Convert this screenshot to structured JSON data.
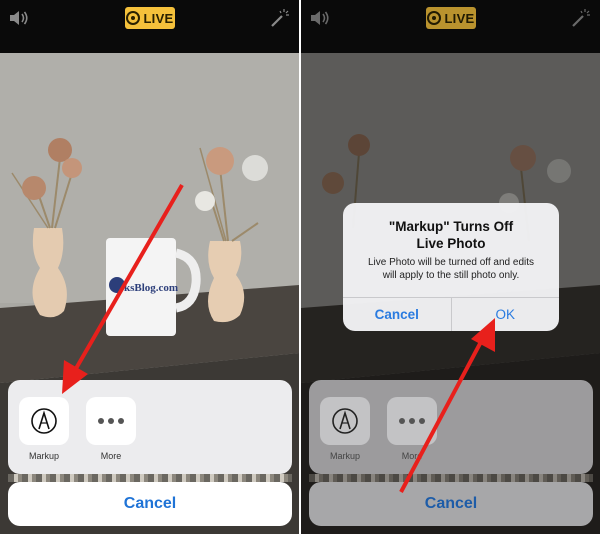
{
  "left": {
    "live_badge": "LIVE",
    "actions": [
      {
        "label": "Markup",
        "icon": "markup-pen-icon"
      },
      {
        "label": "More",
        "icon": "more-dots-icon"
      }
    ],
    "cancel_label": "Cancel",
    "mug_text": "ksBlog.com"
  },
  "right": {
    "live_badge": "LIVE",
    "actions": [
      {
        "label": "Markup",
        "icon": "markup-pen-icon"
      },
      {
        "label": "More",
        "icon": "more-dots-icon"
      }
    ],
    "cancel_label": "Cancel",
    "alert": {
      "title_line1": "\"Markup\" Turns Off",
      "title_line2": "Live Photo",
      "message_line1": "Live Photo will be turned off and edits",
      "message_line2": "will apply to the still photo only.",
      "cancel_label": "Cancel",
      "ok_label": "OK"
    }
  },
  "colors": {
    "live_badge": "#f5c13b",
    "ios_blue": "#2a7be0",
    "arrow_red": "#e8201c"
  }
}
